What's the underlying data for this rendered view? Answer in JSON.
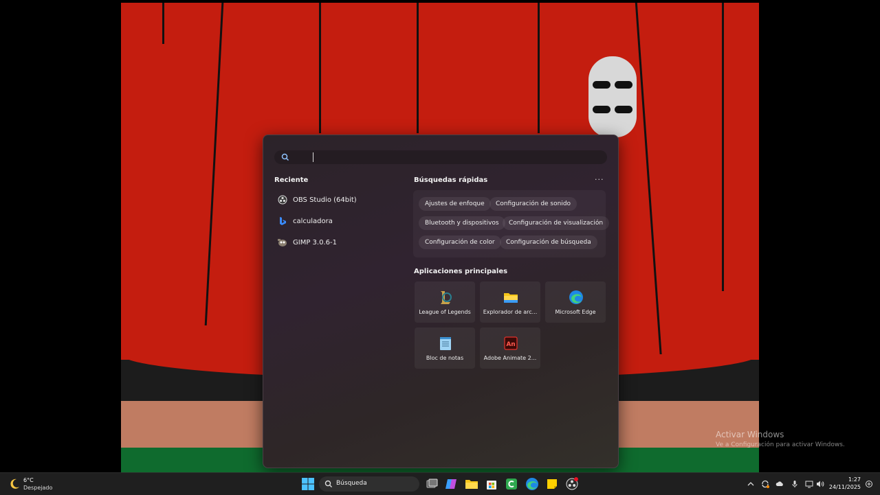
{
  "search": {
    "value": "",
    "placeholder": ""
  },
  "recent": {
    "title": "Reciente",
    "items": [
      {
        "label": "OBS Studio (64bit)",
        "icon": "obs-icon"
      },
      {
        "label": "calculadora",
        "icon": "bing-icon"
      },
      {
        "label": "GIMP 3.0.6-1",
        "icon": "gimp-icon"
      }
    ]
  },
  "quick": {
    "title": "Búsquedas rápidas",
    "more": "···",
    "chips": [
      "Ajustes de enfoque",
      "Configuración de sonido",
      "Bluetooth y dispositivos",
      "Configuración de visualización",
      "Configuración de color",
      "Configuración de búsqueda"
    ]
  },
  "apps": {
    "title": "Aplicaciones principales",
    "items": [
      {
        "label": "League of Legends",
        "icon": "league-of-legends-icon"
      },
      {
        "label": "Explorador de arc...",
        "icon": "file-explorer-icon"
      },
      {
        "label": "Microsoft Edge",
        "icon": "edge-icon"
      },
      {
        "label": "Bloc de notas",
        "icon": "notepad-icon"
      },
      {
        "label": "Adobe Animate 2...",
        "icon": "adobe-animate-icon"
      }
    ]
  },
  "watermark": {
    "title": "Activar Windows",
    "subtitle": "Ve a Configuración para activar Windows."
  },
  "taskbar": {
    "weather": {
      "temp": "6°C",
      "condition": "Despejado"
    },
    "search_label": "Búsqueda",
    "time": "1:27",
    "date": "24/11/2025",
    "pinned": [
      "task-view-icon",
      "copilot-icon",
      "file-explorer-icon",
      "store-icon",
      "camtasia-icon",
      "edge-icon",
      "sticky-notes-icon",
      "obs-icon"
    ]
  },
  "colors": {
    "accent": "#0078d4",
    "curtain": "#c41d0f",
    "panel": "#2c2329"
  }
}
